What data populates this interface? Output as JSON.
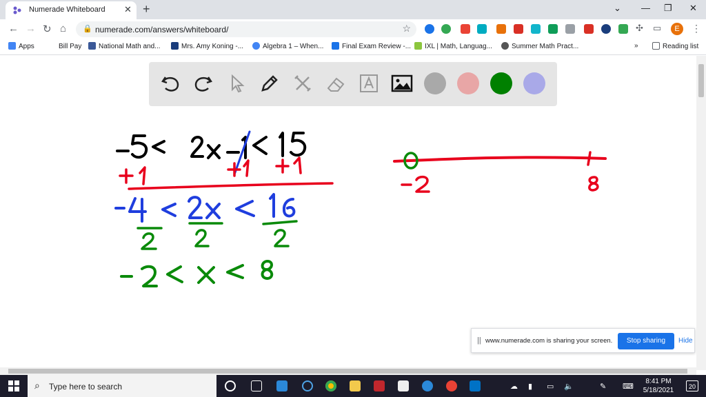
{
  "browser": {
    "tab_title": "Numerade Whiteboard",
    "tab_close": "✕",
    "new_tab": "+",
    "url": "numerade.com/answers/whiteboard/",
    "avatar_letter": "E"
  },
  "bookmarks": [
    {
      "label": "Apps",
      "color": "#4285f4"
    },
    {
      "label": "Bill Pay",
      "color": "#ffffff"
    },
    {
      "label": "National Math and...",
      "color": "#3b5998"
    },
    {
      "label": "Mrs. Amy Koning -...",
      "color": "#1a3d7c"
    },
    {
      "label": "Algebra 1 – When...",
      "color": "#4285f4"
    },
    {
      "label": "Final Exam Review -...",
      "color": "#1a73e8"
    },
    {
      "label": "IXL | Math, Languag...",
      "color": "#8cc63e"
    },
    {
      "label": "Summer Math Pract...",
      "color": "#555555"
    }
  ],
  "bookmarks_more": "»",
  "reading_list": "Reading list",
  "whiteboard": {
    "colors": [
      "#a9a9a9",
      "#e8a6a6",
      "#008000",
      "#a9a9e8"
    ]
  },
  "share_banner": {
    "message": "www.numerade.com is sharing your screen.",
    "stop_label": "Stop sharing",
    "hide_label": "Hide"
  },
  "taskbar": {
    "search_placeholder": "Type here to search",
    "time": "8:41 PM",
    "date": "5/18/2021",
    "notifications": "20"
  }
}
